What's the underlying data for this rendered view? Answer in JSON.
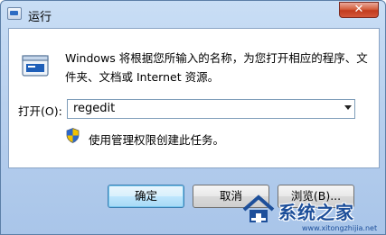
{
  "window": {
    "title": "运行",
    "close_symbol": "✕"
  },
  "body": {
    "icon": "run-program-icon",
    "description": "Windows 将根据您所输入的名称，为您打开相应的程序、文件夹、文档或 Internet 资源。",
    "open_label": "打开(O):",
    "open_value": "regedit",
    "admin_icon": "uac-shield-icon",
    "admin_note": "使用管理权限创建此任务。"
  },
  "buttons": {
    "ok": "确定",
    "cancel": "取消",
    "browse": "浏览(B)..."
  },
  "watermark": {
    "text": "系统之家",
    "url": "www.xitongzhijia.net"
  },
  "colors": {
    "frame": "#b8d0ee",
    "close": "#c23b1d",
    "accent": "#1d4f9a"
  }
}
